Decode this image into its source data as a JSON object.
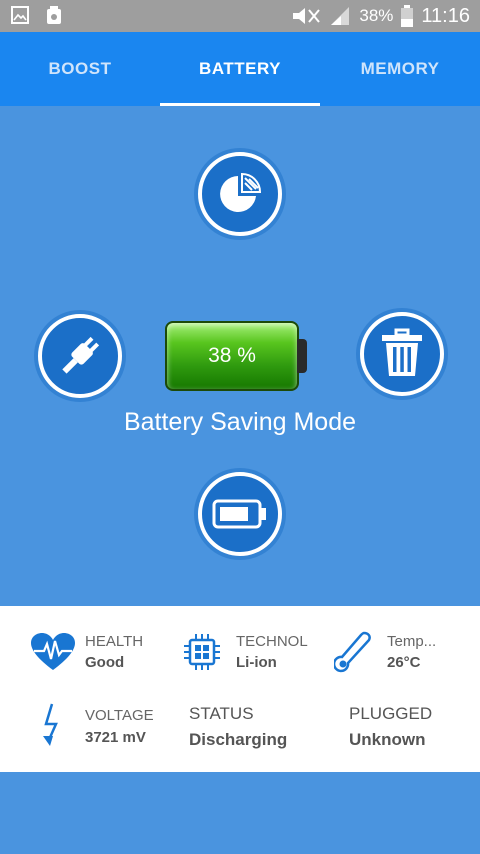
{
  "status_bar": {
    "battery_percent": "38%",
    "time": "11:16"
  },
  "tabs": [
    {
      "label": "BOOST",
      "active": false
    },
    {
      "label": "BATTERY",
      "active": true
    },
    {
      "label": "MEMORY",
      "active": false
    }
  ],
  "battery": {
    "level_text": "38 %",
    "level_fraction": 0.38,
    "mode_label": "Battery Saving Mode"
  },
  "info": {
    "health": {
      "label": "HEALTH",
      "value": "Good"
    },
    "technology": {
      "label": "TECHNOL",
      "value": "Li-ion"
    },
    "temperature": {
      "label": "Temp...",
      "value": "26°C"
    },
    "voltage": {
      "label": "VOLTAGE",
      "value": "3721 mV"
    },
    "status": {
      "label": "STATUS",
      "value": "Discharging"
    },
    "plugged": {
      "label": "PLUGGED",
      "value": "Unknown"
    }
  },
  "colors": {
    "tab_bar": "#1a86f0",
    "background": "#4a94df",
    "icon_blue": "#1976d2",
    "battery_green": "#58c51e"
  }
}
